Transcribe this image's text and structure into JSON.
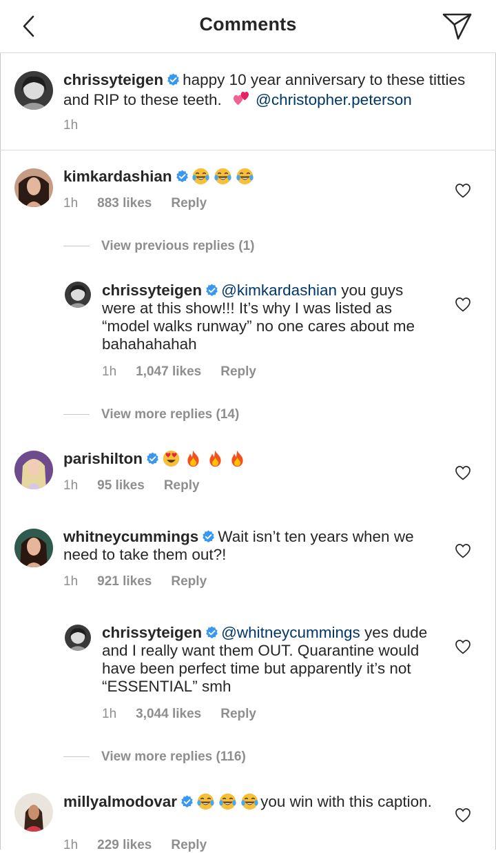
{
  "header": {
    "title": "Comments",
    "back_icon": "chevron-left-icon",
    "send_icon": "paper-plane-icon"
  },
  "caption": {
    "username": "chrissyteigen",
    "text": "happy 10 year anniversary to these titties and RIP to these teeth.",
    "emoji": "💞",
    "mention": "@christopher.peterson",
    "time": "1h"
  },
  "comments": [
    {
      "username": "kimkardashian",
      "text": "😂😂😂",
      "time": "1h",
      "likes": "883 likes",
      "reply": "Reply"
    },
    {
      "view_replies": "View previous replies (1)"
    },
    {
      "username": "chrissyteigen",
      "mention": "@kimkardashian",
      "text": "you guys were at this show!!! It’s why I was listed as “model walks runway” no one cares about me bahahahahah",
      "time": "1h",
      "likes": "1,047 likes",
      "reply": "Reply"
    },
    {
      "view_replies": "View more replies (14)"
    },
    {
      "username": "parishilton",
      "text": "😍🔥🔥🔥",
      "time": "1h",
      "likes": "95 likes",
      "reply": "Reply"
    },
    {
      "username": "whitneycummings",
      "text": "Wait isn’t ten years when we need to take them out?!",
      "time": "1h",
      "likes": "921 likes",
      "reply": "Reply"
    },
    {
      "username": "chrissyteigen",
      "mention": "@whitneycummings",
      "text": "yes dude and I really want them OUT. Quarantine would have been perfect time but apparently it’s not “ESSENTIAL” smh",
      "time": "1h",
      "likes": "3,044 likes",
      "reply": "Reply"
    },
    {
      "view_replies": "View more replies (116)"
    },
    {
      "username": "millyalmodovar",
      "text": "you win with this caption.",
      "emoji": "😂😂😂",
      "time": "1h",
      "likes": "229 likes",
      "reply": "Reply"
    }
  ],
  "colors": {
    "text": "#262626",
    "secondary": "#8e8e8e",
    "mention": "#00376b",
    "verified": "#3897f0",
    "divider": "#dbdbdb"
  }
}
